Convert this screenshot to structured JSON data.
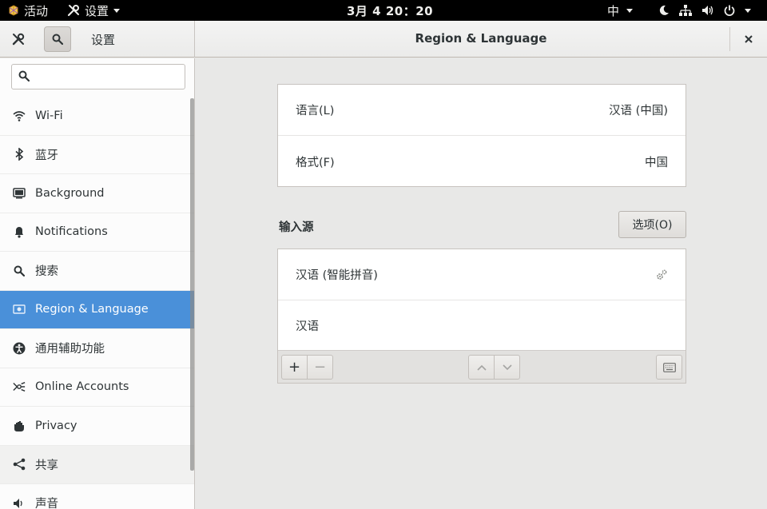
{
  "topbar": {
    "activities": "活动",
    "app_menu": "设置",
    "clock": "3月 4  20：20",
    "ime": "中"
  },
  "headerbar": {
    "settings_title": "设置",
    "panel_title": "Region & Language"
  },
  "sidebar": {
    "search_placeholder": "",
    "items": [
      {
        "label": "Wi-Fi",
        "icon": "wifi-icon"
      },
      {
        "label": "蓝牙",
        "icon": "bluetooth-icon"
      },
      {
        "label": "Background",
        "icon": "background-icon"
      },
      {
        "label": "Notifications",
        "icon": "bell-icon"
      },
      {
        "label": "搜索",
        "icon": "search-icon"
      },
      {
        "label": "Region & Language",
        "icon": "flag-icon"
      },
      {
        "label": "通用辅助功能",
        "icon": "accessibility-icon"
      },
      {
        "label": "Online Accounts",
        "icon": "online-accounts-icon"
      },
      {
        "label": "Privacy",
        "icon": "hand-icon"
      },
      {
        "label": "共享",
        "icon": "share-icon"
      },
      {
        "label": "声音",
        "icon": "speaker-icon"
      }
    ]
  },
  "main": {
    "language_label": "语言(L)",
    "language_value": "汉语 (中国)",
    "formats_label": "格式(F)",
    "formats_value": "中国",
    "input_sources_label": "输入源",
    "options_button": "选项(O)",
    "input_sources": [
      {
        "label": "汉语 (智能拼音)"
      },
      {
        "label": "汉语"
      }
    ],
    "toolbar": {
      "add": "+",
      "remove": "−"
    }
  },
  "colors": {
    "accent": "#4a90d9",
    "topbar": "#000000",
    "content_bg": "#e8e8e7"
  }
}
